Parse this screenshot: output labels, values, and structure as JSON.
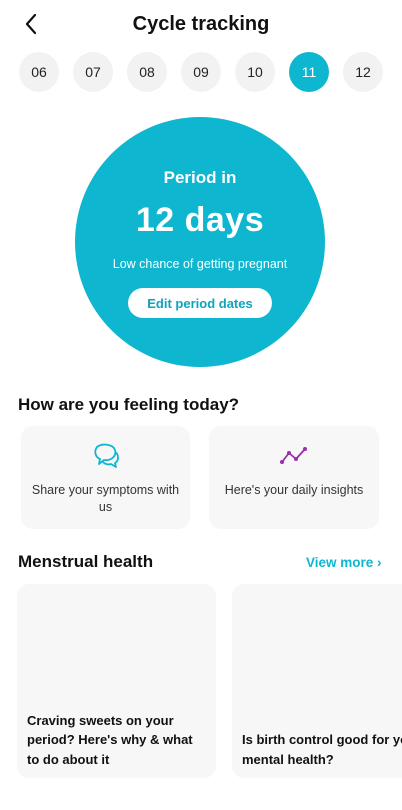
{
  "header": {
    "title": "Cycle tracking",
    "back_icon": "chevron-left-icon"
  },
  "days": {
    "items": [
      "06",
      "07",
      "08",
      "09",
      "10",
      "11",
      "12"
    ],
    "selected": "11"
  },
  "status": {
    "label": "Period in",
    "days_text": "12 days",
    "subtitle": "Low chance of getting pregnant",
    "edit_button": "Edit period dates"
  },
  "feeling": {
    "heading": "How are you feeling today?",
    "cards": [
      {
        "text": "Share your symptoms with us",
        "icon": "chat-bubbles-icon"
      },
      {
        "text": "Here's your daily insights",
        "icon": "trend-line-icon"
      }
    ]
  },
  "health": {
    "heading": "Menstrual health",
    "view_more": "View more ›",
    "articles": [
      {
        "title": "Craving sweets on your period? Here's why & what to do about it"
      },
      {
        "title": "Is birth control good for your mental health?"
      }
    ]
  },
  "colors": {
    "accent": "#0fb6d0",
    "insight_icon": "#9b2fae",
    "card_bg": "#f7f7f7"
  }
}
